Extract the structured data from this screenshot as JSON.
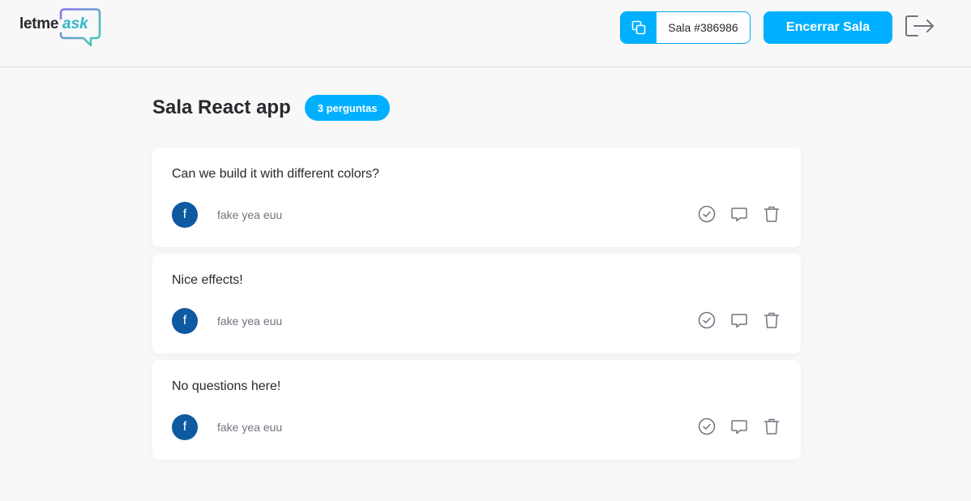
{
  "header": {
    "logo": {
      "text_letme": "letme",
      "text_ask": "ask"
    },
    "room_code": {
      "label": "Sala #386986",
      "icon": "copy-icon"
    },
    "close_room_label": "Encerrar Sala",
    "logout_icon": "logout-icon"
  },
  "main": {
    "title": "Sala React app",
    "question_count": "3 perguntas",
    "questions": [
      {
        "content": "Can we build it with different colors?",
        "author_initial": "f",
        "author": "fake yea euu"
      },
      {
        "content": "Nice effects!",
        "author_initial": "f",
        "author": "fake yea euu"
      },
      {
        "content": "No questions here!",
        "author_initial": "f",
        "author": "fake yea euu"
      }
    ],
    "question_actions": [
      "check-icon",
      "answer-icon",
      "trash-icon"
    ]
  },
  "colors": {
    "accent": "#00b0ff",
    "avatar": "#0d5aa0",
    "background": "#f8f8f8",
    "text": "#29292e",
    "muted": "#737380"
  }
}
